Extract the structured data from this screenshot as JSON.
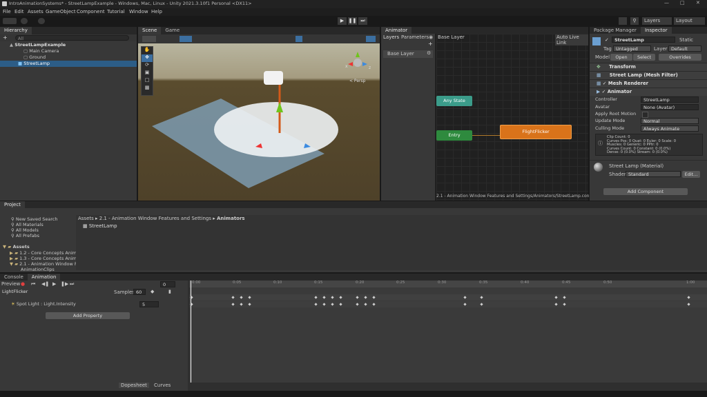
{
  "window_title": "IntroAnimationSystems* - StreetLampExample - Windows, Mac, Linux - Unity 2021.3.10f1 Personal <DX11>",
  "menu": [
    "File",
    "Edit",
    "Assets",
    "GameObject",
    "Component",
    "Tutorial",
    "Window",
    "Help"
  ],
  "toolbar": {
    "layers": "Layers",
    "layout": "Layout"
  },
  "hierarchy": {
    "tab": "Hierarchy",
    "search_placeholder": "All",
    "items": [
      {
        "label": "StreetLampExample"
      },
      {
        "label": "Main Camera"
      },
      {
        "label": "Ground"
      },
      {
        "label": "StreetLamp"
      }
    ]
  },
  "scene": {
    "tab_scene": "Scene",
    "tab_game": "Game",
    "persp": "< Persp",
    "gizmo_x": "x",
    "gizmo_z": "z"
  },
  "animator": {
    "tab": "Animator",
    "layers_tab": "Layers",
    "parameters_tab": "Parameters",
    "base_layer_crumb": "Base Layer",
    "auto_live_link": "Auto Live Link",
    "base_layer": "Base Layer",
    "any_state": "Any State",
    "entry": "Entry",
    "flight_flicker": "FlightFlicker",
    "path": "2.1 - Animation Window Features and Settings/Animators/StreetLamp.con"
  },
  "inspector": {
    "tab_package": "Package Manager",
    "tab_inspector": "Inspector",
    "object_name": "StreetLamp",
    "static": "Static",
    "tag_label": "Tag",
    "tag_value": "Untagged",
    "layer_label": "Layer",
    "layer_value": "Default",
    "model_label": "Model",
    "open": "Open",
    "select": "Select",
    "overrides": "Overrides",
    "components": [
      "Transform",
      "Street Lamp (Mesh Filter)",
      "Mesh Renderer",
      "Animator"
    ],
    "animator_fields": [
      {
        "label": "Controller",
        "value": "StreetLamp"
      },
      {
        "label": "Avatar",
        "value": "None (Avatar)"
      },
      {
        "label": "Apply Root Motion",
        "value": ""
      },
      {
        "label": "Update Mode",
        "value": "Normal"
      },
      {
        "label": "Culling Mode",
        "value": "Always Animate"
      }
    ],
    "info_lines": [
      "Clip Count: 0",
      "Curves Pos: 0 Quat: 0 Euler: 0 Scale: 0",
      "Muscles: 0 Generic: 0 PPtr: 0",
      "Curves Count: 0 Constant: 0 (0.0%)",
      "Dense: 0 (0.0%) Stream: 0 (0.0%)"
    ],
    "material_name": "Street Lamp (Material)",
    "shader_label": "Shader",
    "shader_value": "Standard",
    "edit": "Edit...",
    "add_component": "Add Component"
  },
  "project": {
    "tab": "Project",
    "favorites": [
      "New Saved Search",
      "All Materials",
      "All Models",
      "All Prefabs"
    ],
    "assets_label": "Assets",
    "folders": [
      "1.2 - Core Concepts Anim",
      "1.3 - Core Concepts Anim",
      "2.1 - Animation Window F",
      "AnimationClips"
    ],
    "breadcrumb": [
      "Assets",
      "2.1 - Animation Window Features and Settings",
      "Animators"
    ],
    "items": [
      "StreetLamp"
    ]
  },
  "animation": {
    "tab_console": "Console",
    "tab_animation": "Animation",
    "preview": "Preview",
    "frame": "0",
    "clip": "LightFlicker",
    "samples_label": "Samples",
    "samples_value": "60",
    "property": "Spot Light : Light.Intensity",
    "property_value": "5",
    "add_property": "Add Property",
    "dopesheet": "Dopesheet",
    "curves": "Curves",
    "ruler": [
      "0:00",
      "0:05",
      "0:10",
      "0:15",
      "0:20",
      "0:25",
      "0:30",
      "0:35",
      "0:40",
      "0:45",
      "0:50",
      "1:00"
    ]
  }
}
